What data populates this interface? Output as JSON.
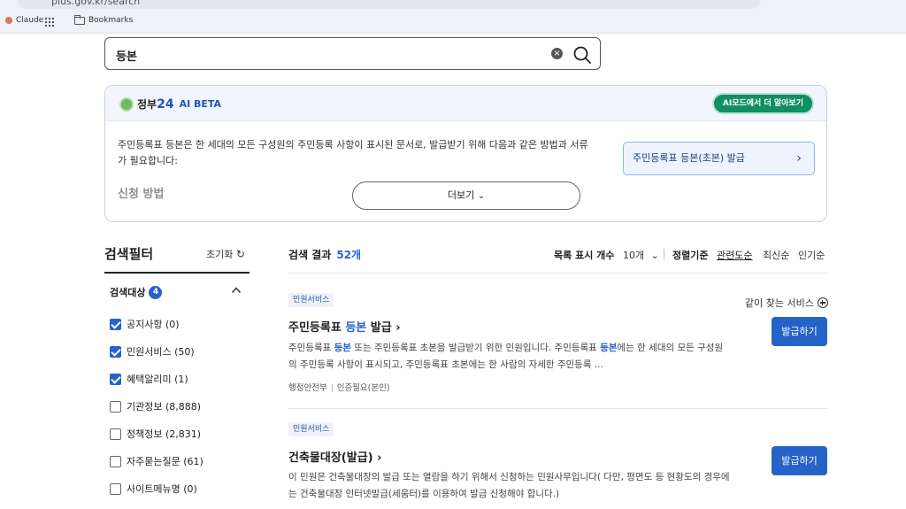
{
  "browser": {
    "url": "plus.gov.kr/search",
    "bookmarks": [
      {
        "label": "Claude"
      },
      {
        "label": "Bookmarks"
      }
    ]
  },
  "search": {
    "query": "등본",
    "clear_label": "×"
  },
  "ai_panel": {
    "brand": "정부",
    "brand_num": "24",
    "beta_label": "AI BETA",
    "mode_button": "AI모드에서 더 알아보기",
    "summary": "주민등록표 등본은 한 세대의 모든 구성원의 주민등록 사항이 표시된 문서로, 발급받기 위해 다음과 같은 방법과 서류가 필요합니다:",
    "method_heading": "신청 방법",
    "more_button": "더보기",
    "issue_link": "주민등록표 등본(초본) 발급"
  },
  "filter": {
    "title": "검색필터",
    "reset_label": "초기화",
    "group_label": "검색대상",
    "group_count": "4",
    "options": [
      {
        "label": "공지사항 (0)",
        "checked": true
      },
      {
        "label": "민원서비스 (50)",
        "checked": true
      },
      {
        "label": "혜택알리미 (1)",
        "checked": true
      },
      {
        "label": "기관정보 (8,888)",
        "checked": false
      },
      {
        "label": "정책정보 (2,831)",
        "checked": false
      },
      {
        "label": "자주묻는질문 (61)",
        "checked": false
      },
      {
        "label": "사이트메뉴명 (0)",
        "checked": false
      }
    ]
  },
  "results": {
    "title": "검색 결과",
    "count": "52개",
    "list_count_label": "목록 표시 개수",
    "list_count_value": "10개",
    "sort_label": "정렬기준",
    "sort_options": [
      "관련도순",
      "최신순",
      "인기순"
    ],
    "related_label": "같이 찾는 서비스",
    "items": [
      {
        "category": "민원서비스",
        "title_pre": "주민등록표 ",
        "title_hl": "등본",
        "title_post": " 발급",
        "desc_line1_a": "주민등록표 ",
        "desc_line1_hl": "등본",
        "desc_line1_b": " 또는 주민등록표 초본을 발급받기 위한 민원입니다. 주민등록표 ",
        "desc_line1_hl2": "등본",
        "desc_line1_c": "에는 한 세대의 모든 구성원",
        "desc_line2": "의 주민등록 사항이 표시되고, 주민등록표 초본에는 한 사람의 자세한 주민등록 ...",
        "meta_org": "행정안전부",
        "meta_auth": "인증필요(본인)",
        "button": "발급하기"
      },
      {
        "category": "민원서비스",
        "title": "건축물대장(발급)",
        "desc_line1": "이 민원은 건축물대장의 발급 또는 열람을 하기 위해서 신청하는 민원사무입니다( 다만, 평면도 등 현황도의 경우에",
        "desc_line2": "는 건축물대장 인터넷발급(세움터)를 이용하여 발급 신청해야 합니다.)",
        "button": "발급하기"
      }
    ]
  }
}
